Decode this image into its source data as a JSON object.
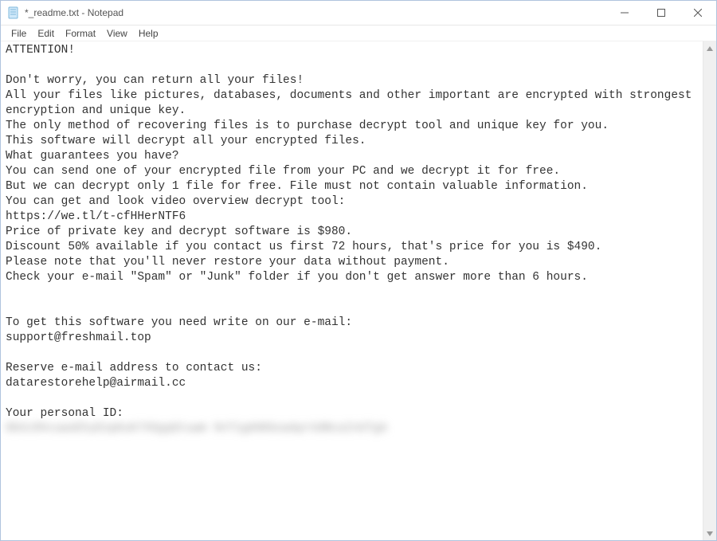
{
  "window": {
    "title": "*_readme.txt - Notepad"
  },
  "menu": {
    "file": "File",
    "edit": "Edit",
    "format": "Format",
    "view": "View",
    "help": "Help"
  },
  "body": {
    "line1": "ATTENTION!",
    "line2": "",
    "line3": "Don't worry, you can return all your files!",
    "line4": "All your files like pictures, databases, documents and other important are encrypted with strongest encryption and unique key.",
    "line5": "The only method of recovering files is to purchase decrypt tool and unique key for you.",
    "line6": "This software will decrypt all your encrypted files.",
    "line7": "What guarantees you have?",
    "line8": "You can send one of your encrypted file from your PC and we decrypt it for free.",
    "line9": "But we can decrypt only 1 file for free. File must not contain valuable information.",
    "line10": "You can get and look video overview decrypt tool:",
    "line11": "https://we.tl/t-cfHHerNTF6",
    "line12": "Price of private key and decrypt software is $980.",
    "line13": "Discount 50% available if you contact us first 72 hours, that's price for you is $490.",
    "line14": "Please note that you'll never restore your data without payment.",
    "line15": "Check your e-mail \"Spam\" or \"Junk\" folder if you don't get answer more than 6 hours.",
    "line16": "",
    "line17": "",
    "line18": "To get this software you need write on our e-mail:",
    "line19": "support@freshmail.top",
    "line20": "",
    "line21": "Reserve e-mail address to contact us:",
    "line22": "datarestorehelp@airmail.cc",
    "line23": "",
    "line24": "Your personal ID:",
    "blurred_id": "0bXz9hcuwoEhyEnpKuK7XGgqGtuwm 9nT1gAHKboaAprUdNcaInUTgA"
  }
}
